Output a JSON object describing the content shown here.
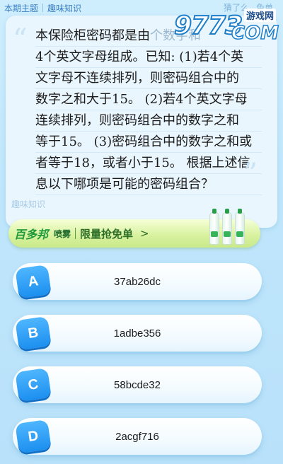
{
  "header": {
    "tabs": [
      "本期主题",
      "趣味知识"
    ],
    "right_items": [
      "猜了么",
      "免单"
    ]
  },
  "watermark": {
    "brand_big": "9773",
    "brand_small": "游戏网",
    "brand_com": "COM"
  },
  "question": {
    "lines": [
      "本保险柜密码都是由",
      "4个英文字母组成。已知: (1)若4个英",
      "文字母不连续排列，则密码组合中的",
      "数字之和大于15。 (2)若4个英文字母",
      "连续排列，则密码组合中的数字之和",
      "等于15。 (3)密码组合中的数字之和或",
      "者等于18，或者小于15。 根据上述信",
      "息以下哪项是可能的密码组合？"
    ],
    "line1_suffix": "个数字和",
    "footer": "趣味知识"
  },
  "ad": {
    "logo": "百多邦",
    "tag": "喷雾",
    "text": "限量抢免单",
    "arrow": ">"
  },
  "options": [
    {
      "letter": "A",
      "text": "37ab26dc"
    },
    {
      "letter": "B",
      "text": "1adbe356"
    },
    {
      "letter": "C",
      "text": "58bcde32"
    },
    {
      "letter": "D",
      "text": "2acgf716"
    }
  ]
}
